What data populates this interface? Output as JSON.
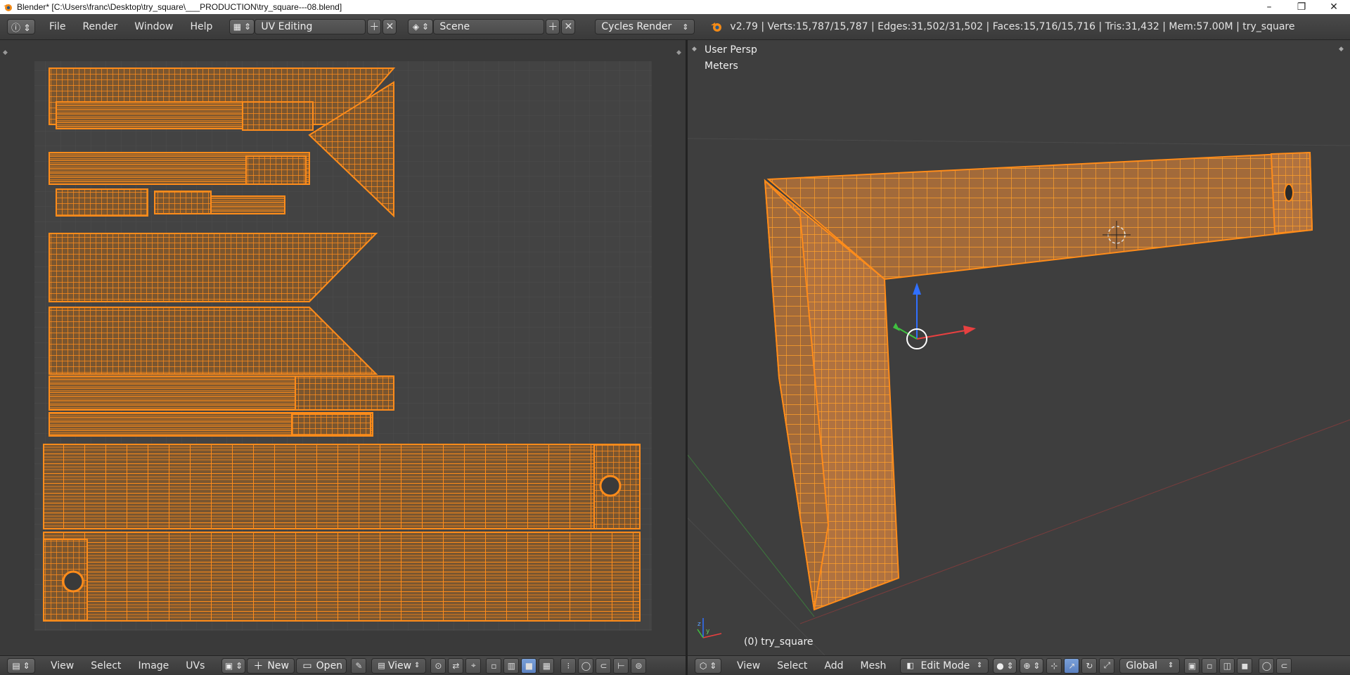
{
  "window": {
    "title": "Blender* [C:\\Users\\franc\\Desktop\\try_square\\___PRODUCTION\\try_square---08.blend]",
    "controls": [
      "–",
      "❐",
      "✕"
    ]
  },
  "infobar": {
    "menus": [
      "File",
      "Render",
      "Window",
      "Help"
    ],
    "screen_layout": "UV Editing",
    "scene": "Scene",
    "render_engine": "Cycles Render",
    "stats": "v2.79 | Verts:15,787/15,787 | Edges:31,502/31,502 | Faces:15,716/15,716 | Tris:31,432 | Mem:57.00M | try_square"
  },
  "uv_footer": {
    "menus": [
      "View",
      "Select",
      "Image",
      "UVs"
    ],
    "new_label": "New",
    "open_label": "Open",
    "view_label": "View"
  },
  "viewport": {
    "view_name": "User Persp",
    "units": "Meters",
    "object_label": "(0) try_square",
    "axis_y": "y",
    "axis_z": "z"
  },
  "viewport_footer": {
    "menus": [
      "View",
      "Select",
      "Add",
      "Mesh"
    ],
    "mode": "Edit Mode",
    "orientation": "Global"
  },
  "colors": {
    "mesh": "#ff8c1a",
    "face_fill": "#7a5630",
    "grid": "#555555",
    "x_axis": "#e84040",
    "y_axis": "#40c040",
    "z_axis": "#3070ff"
  }
}
